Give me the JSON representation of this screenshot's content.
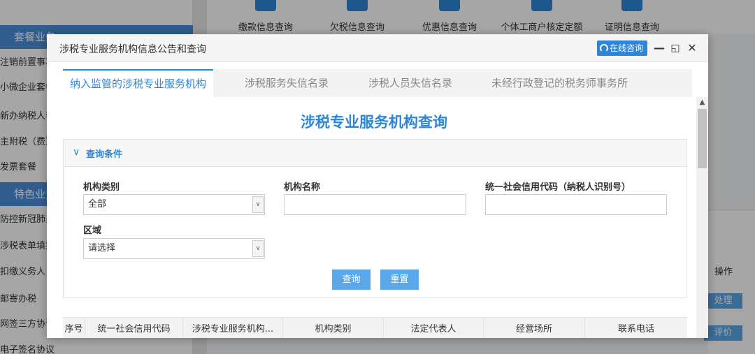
{
  "background": {
    "sidebar": {
      "sections": [
        "套餐业务",
        "特色业务"
      ],
      "items": [
        "注销前置事项",
        "小微企业套餐",
        "新办纳税人套餐",
        "主附税（费）",
        "发票套餐",
        "防控新冠肺炎",
        "涉税表单填报",
        "扣缴义务人",
        "邮寄办税",
        "网签三方协议",
        "电子签名协议"
      ]
    },
    "topbar": {
      "tiles": [
        "缴款信息查询",
        "欠税信息查询",
        "优惠信息查询",
        "个体工商户核定定额",
        "证明信息查询"
      ]
    },
    "panel": {
      "op_header": "操作",
      "process_button": "处理",
      "rate_button": "评价"
    }
  },
  "modal": {
    "title": "涉税专业服务机构信息公告和查询",
    "online_consult": "在线咨询",
    "minimize": "—",
    "maximize": "◱",
    "close": "✕",
    "tabs": [
      {
        "label": "纳入监管的涉税专业服务机构",
        "active": true
      },
      {
        "label": "涉税服务失信名录",
        "active": false
      },
      {
        "label": "涉税人员失信名录",
        "active": false
      },
      {
        "label": "未经行政登记的税务师事务所",
        "active": false
      }
    ],
    "search_title": "涉税专业服务机构查询",
    "criteria": {
      "header": "查询条件",
      "org_type_label": "机构类别",
      "org_type_value": "全部",
      "org_name_label": "机构名称",
      "org_name_value": "",
      "credit_code_label": "统一社会信用代码（纳税人识别号）",
      "credit_code_value": "",
      "region_label": "区域",
      "region_value": "请选择",
      "query_button": "查询",
      "reset_button": "重置"
    },
    "table": {
      "columns": [
        "序号",
        "统一社会信用代码",
        "涉税专业服务机构...",
        "机构类别",
        "法定代表人",
        "经营场所",
        "联系电话"
      ]
    }
  },
  "colors": {
    "accent": "#2f86d8",
    "button": "#5aa7ea",
    "sidebar_section": "#4a90d9"
  }
}
